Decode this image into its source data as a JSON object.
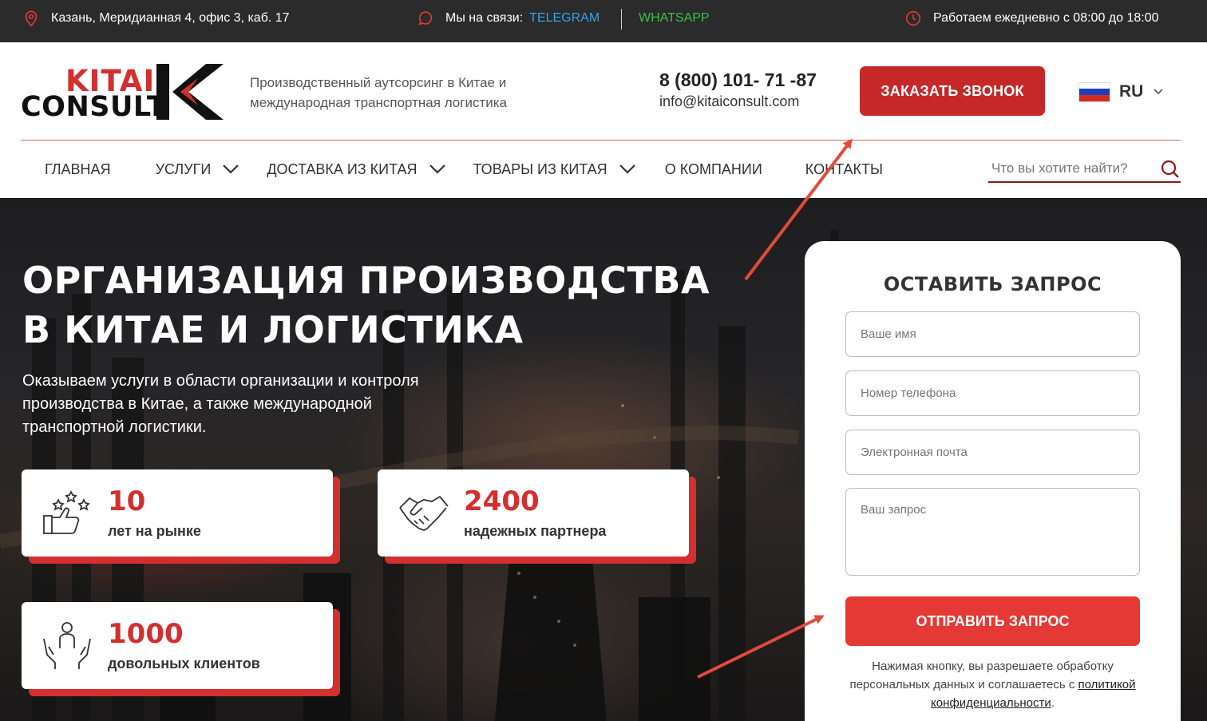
{
  "topbar": {
    "address": "Казань, Меридианная 4, офис 3, каб. 17",
    "contact_label": "Мы на связи:",
    "telegram": "TELEGRAM",
    "whatsapp": "WHATSAPP",
    "hours": "Работаем ежедневно с 08:00 до 18:00"
  },
  "header": {
    "logo_top": "KITAI",
    "logo_bottom": "CONSULT",
    "tagline": "Производственный аутсорсинг в Китае и международная транспортная логистика",
    "phone": "8 (800) 101- 71 -87",
    "email": "info@kitaiconsult.com",
    "call_button": "ЗАКАЗАТЬ ЗВОНОК",
    "language": "RU"
  },
  "nav": {
    "items": [
      {
        "label": "ГЛАВНАЯ",
        "dropdown": false
      },
      {
        "label": "УСЛУГИ",
        "dropdown": true
      },
      {
        "label": "ДОСТАВКА ИЗ КИТАЯ",
        "dropdown": true
      },
      {
        "label": "ТОВАРЫ ИЗ КИТАЯ",
        "dropdown": true
      },
      {
        "label": "О КОМПАНИИ",
        "dropdown": false
      },
      {
        "label": "КОНТАКТЫ",
        "dropdown": false
      }
    ],
    "search_placeholder": "Что вы хотите найти?"
  },
  "hero": {
    "title": "ОРГАНИЗАЦИЯ ПРОИЗВОДСТВА В КИТАЕ И ЛОГИСТИКА",
    "subtitle": "Оказываем услуги в области организации и контроля производства в Китае, а также международной транспортной логистики.",
    "stats": [
      {
        "value": "10",
        "label": "лет на рынке",
        "icon": "thumbs-up-stars-icon"
      },
      {
        "value": "2400",
        "label": "надежных партнера",
        "icon": "handshake-icon"
      },
      {
        "value": "1000",
        "label": "довольных клиентов",
        "icon": "person-hands-icon"
      }
    ]
  },
  "form": {
    "title": "ОСТАВИТЬ ЗАПРОС",
    "name_placeholder": "Ваше имя",
    "phone_placeholder": "Номер телефона",
    "email_placeholder": "Электронная почта",
    "request_placeholder": "Ваш запрос",
    "submit": "ОТПРАВИТЬ ЗАПРОС",
    "consent_text": "Нажимая кнопку, вы разрешаете обработку персональных данных и соглашаетесь с",
    "consent_link": "политикой конфиденциальности",
    "consent_end": "."
  },
  "colors": {
    "accent": "#c62828",
    "button_red": "#e53935",
    "topbar_bg": "#2b2b2b",
    "telegram": "#3aa0e8",
    "whatsapp": "#38c24a"
  }
}
